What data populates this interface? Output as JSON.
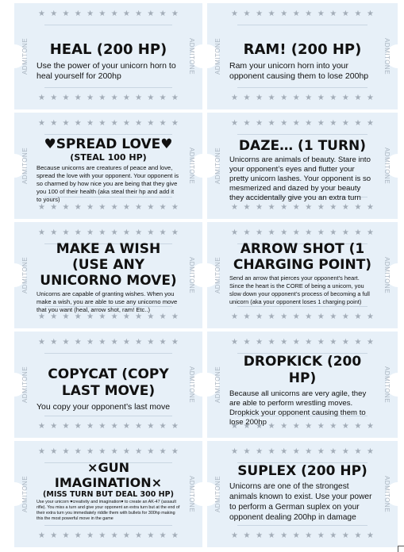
{
  "ticket_stub_label": "ADMITONE",
  "star_glyph": "★",
  "cards": [
    {
      "id": "heal",
      "title": "HEAL (200 HP)",
      "subtitle": "",
      "description": "Use the power of your unicorn horn to heal yourself for 200hp"
    },
    {
      "id": "ram",
      "title": "RAM! (200 HP)",
      "subtitle": "",
      "description": "Ram your unicorn horn into your opponent causing them to lose 200hp"
    },
    {
      "id": "spread-love",
      "title": "♥SPREAD LOVE♥",
      "subtitle": "(STEAL 100 HP)",
      "description": "Because unicorns are creatures of peace and love, spread the love with your opponent. Your opponent is so charmed by how nice you are being that they give you 100 of their health (aka steal their hp and add it to yours)"
    },
    {
      "id": "daze",
      "title": "DAZE… (1 TURN)",
      "subtitle": "",
      "description": "Unicorns are animals of beauty. Stare into your opponent’s eyes and flutter your pretty unicorn lashes. Your opponent is so mesmerized and dazed by your beauty they accidentally give you an extra turn"
    },
    {
      "id": "make-a-wish",
      "title": "MAKE A WISH (USE ANY UNICORNO MOVE)",
      "subtitle": "",
      "description": "Unicorns are capable of granting wishes. When you make a wish, you are able to use any unicorno move that you want (heal, arrow shot, ram! Etc..)"
    },
    {
      "id": "arrow-shot",
      "title": "ARROW SHOT (1 CHARGING POINT)",
      "subtitle": "",
      "description": "Send an arrow that pierces your opponent’s heart. Since the heart is the CORE of being a unicorn, you slow down your opponent’s process of becoming a full unicorn (aka your opponent loses 1 charging point)"
    },
    {
      "id": "copycat",
      "title": "COPYCAT (COPY LAST MOVE)",
      "subtitle": "",
      "description": "You copy your opponent’s last move"
    },
    {
      "id": "dropkick",
      "title": "DROPKICK (200 HP)",
      "subtitle": "",
      "description": "Because all unicorns are very agile, they are able to perform wrestling moves. Dropkick your opponent causing them to lose 200hp"
    },
    {
      "id": "gun-imagination",
      "title": "×GUN IMAGINATION×",
      "subtitle": "(MISS TURN BUT DEAL 300 HP)",
      "description": "Use your unicorn ♥creativity and imagination♥ to create an AK-47 (assault rifle). You miss a turn and give your opponent an extra turn but at the end of their extra turn you immediately riddle them with bullets for 300hp making this the most powerful move in the game"
    },
    {
      "id": "suplex",
      "title": "SUPLEX (200 HP)",
      "subtitle": "",
      "description": "Unicorns are one of the strongest animals known to exist. Use your power to perform a German suplex on your opponent dealing 200hp in damage"
    }
  ]
}
